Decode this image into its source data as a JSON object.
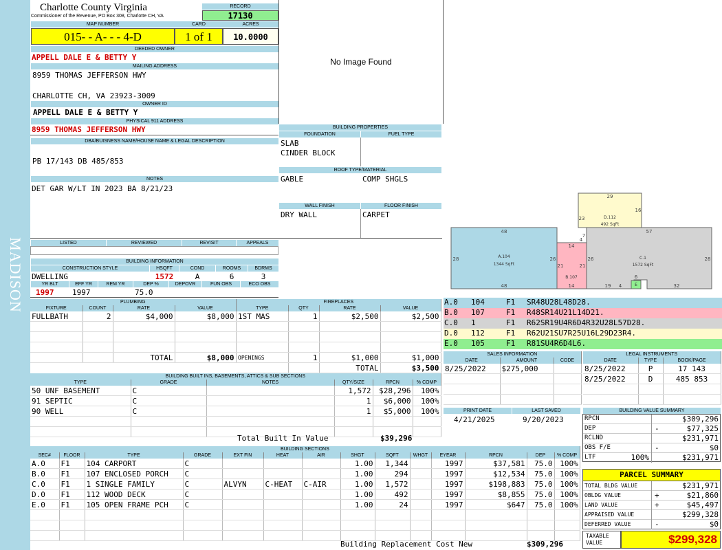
{
  "sidebar_label": "MADISON",
  "county": {
    "title": "Charlotte County Virginia",
    "subtitle": "Commissioner of the Revenue, PO Box 308, Charlotte CH, VA"
  },
  "record": {
    "label": "RECORD",
    "value": "17130"
  },
  "map": {
    "label": "MAP NUMBER",
    "value": "015- - A- - - 4-D"
  },
  "card": {
    "label": "CARD",
    "value": "1 of 1"
  },
  "acres": {
    "label": "ACRES",
    "value": "10.0000"
  },
  "deeded_owner": {
    "label": "DEEDED OWNER",
    "value": "APPELL DALE E & BETTY Y"
  },
  "mailing": {
    "label": "MAILING ADDRESS",
    "line1": "8959 THOMAS JEFFERSON HWY",
    "line2": "CHARLOTTE CH, VA 23923-3009"
  },
  "owner_id": {
    "label": "OWNER ID",
    "value": "APPELL DALE E & BETTY Y"
  },
  "physical": {
    "label": "PHYSICAL 911 ADDRESS",
    "value": "8959 THOMAS JEFFERSON HWY"
  },
  "legal_desc": {
    "label": "DBA/BUISNESS NAME/HOUSE NAME & LEGAL DESCRIPTION",
    "value": "PB 17/143 DB 485/853"
  },
  "notes": {
    "label": "NOTES",
    "value": "DET GAR W/LT IN 2023 BA 8/21/23"
  },
  "status_headers": [
    "LISTED",
    "REVIEWED",
    "REVISIT",
    "APPEALS"
  ],
  "image_placeholder": "No Image Found",
  "building_props": {
    "label": "BUILDING PROPERTIES",
    "foundation_label": "FOUNDATION",
    "fuel_label": "FUEL TYPE",
    "foundation": [
      "SLAB",
      "CINDER BLOCK"
    ],
    "roof_label": "ROOF TYPE/MATERIAL",
    "roof_type": "GABLE",
    "roof_material": "COMP SHGLS",
    "wall_label": "WALL FINISH",
    "floor_label": "FLOOR FINISH",
    "wall": "DRY WALL",
    "floor": "CARPET"
  },
  "building_info": {
    "label": "BUILDING INFORMATION",
    "h1": [
      "CONSTRUCTION STYLE",
      "HSQFT",
      "COND",
      "ROOMS",
      "BDRMS"
    ],
    "v1": [
      "DWELLING",
      "1572",
      "A",
      "6",
      "3"
    ],
    "h2": [
      "YR BLT",
      "EFF YR",
      "REM YR",
      "DEP %",
      "DEPOVR",
      "FUN OBS",
      "ECO OBS"
    ],
    "v2": [
      "1997",
      "1997",
      "",
      "75.0",
      "",
      "",
      ""
    ]
  },
  "plumbing": {
    "label": "PLUMBING",
    "headers": [
      "FIXTURE",
      "COUNT",
      "RATE",
      "VALUE"
    ],
    "rows": [
      [
        "FULLBATH",
        "2",
        "$4,000",
        "$8,000"
      ]
    ],
    "total_label": "TOTAL",
    "total": "$8,000"
  },
  "fireplaces": {
    "label": "FIREPLACES",
    "headers": [
      "TYPE",
      "QTY",
      "RATE",
      "VALUE"
    ],
    "rows": [
      [
        "1ST MAS",
        "1",
        "$2,500",
        "$2,500"
      ]
    ],
    "openings_label": "OPENINGS",
    "openings": [
      "1",
      "$1,000",
      "$1,000"
    ],
    "total_label": "TOTAL",
    "total": "$3,500"
  },
  "sketch": {
    "labels": [
      {
        "name": "A.104",
        "area": "1344 SqFt"
      },
      {
        "name": "B.107",
        "area": ""
      },
      {
        "name": "C.1",
        "area": "1572 SqFt"
      },
      {
        "name": "D.112",
        "area": "492 SqFt"
      },
      {
        "name": "E",
        "area": ""
      }
    ],
    "dims": [
      "48",
      "28",
      "26",
      "48",
      "14",
      "21",
      "21",
      "14",
      "7",
      "4",
      "23",
      "16",
      "29",
      "57",
      "26",
      "28",
      "19",
      "4",
      "6",
      "32"
    ]
  },
  "sketch_legend": [
    {
      "code": "A.0",
      "num": "104",
      "fl": "F1",
      "path": "SR48U28L48D28.",
      "color": "#add8e6"
    },
    {
      "code": "B.0",
      "num": "107",
      "fl": "F1",
      "path": "R48SR14U21L14D21.",
      "color": "#ffb6c1"
    },
    {
      "code": "C.0",
      "num": "1",
      "fl": "F1",
      "path": "R62SR19U4R6D4R32U28L57D28.",
      "color": "#d3d3d3"
    },
    {
      "code": "D.0",
      "num": "112",
      "fl": "F1",
      "path": "R62U21SU7R25U16L29D23R4.",
      "color": "#fffacd"
    },
    {
      "code": "E.0",
      "num": "105",
      "fl": "F1",
      "path": "R81SU4R6D4L6.",
      "color": "#90ee90"
    }
  ],
  "sales": {
    "label": "SALES INFORMATION",
    "headers": [
      "DATE",
      "AMOUNT",
      "CODE"
    ],
    "rows": [
      [
        "8/25/2022",
        "$275,000",
        ""
      ]
    ]
  },
  "legal": {
    "label": "LEGAL INSTRUMENTS",
    "headers": [
      "DATE",
      "TYPE",
      "BOOK/PAGE"
    ],
    "rows": [
      [
        "8/25/2022",
        "P",
        "17 143"
      ],
      [
        "8/25/2022",
        "D",
        "485 853"
      ]
    ]
  },
  "print": {
    "label": "PRINT DATE",
    "value": "4/21/2025"
  },
  "saved": {
    "label": "LAST SAVED",
    "value": "9/20/2023"
  },
  "builtins": {
    "label": "BUILDING BUILT INS, BASEMENTS, ATTICS & SUB SECTIONS",
    "headers": [
      "TYPE",
      "GRADE",
      "NOTES",
      "QTY/SIZE",
      "RPCN",
      "% COMP"
    ],
    "rows": [
      [
        "50 UNF BASEMENT",
        "C",
        "",
        "1,572",
        "$28,296",
        "100%"
      ],
      [
        "91 SEPTIC",
        "C",
        "",
        "1",
        "$6,000",
        "100%"
      ],
      [
        "90 WELL",
        "C",
        "",
        "1",
        "$5,000",
        "100%"
      ]
    ],
    "total_label": "Total Built In Value",
    "total": "$39,296"
  },
  "sections": {
    "label": "BUILDING SECTIONS",
    "headers": [
      "SEC#",
      "FLOOR",
      "TYPE",
      "GRADE",
      "EXT FIN",
      "HEAT",
      "AIR",
      "SHGT",
      "SQFT",
      "WHGT",
      "EYEAR",
      "RPCN",
      "DEP",
      "% COMP"
    ],
    "rows": [
      [
        "A.0",
        "F1",
        "104 CARPORT",
        "C",
        "",
        "",
        "",
        "1.00",
        "1,344",
        "",
        "1997",
        "$37,581",
        "75.0",
        "100%"
      ],
      [
        "B.0",
        "F1",
        "107 ENCLOSED PORCH",
        "C",
        "",
        "",
        "",
        "1.00",
        "294",
        "",
        "1997",
        "$12,534",
        "75.0",
        "100%"
      ],
      [
        "C.0",
        "F1",
        "1 SINGLE FAMILY",
        "C",
        "ALVYN",
        "C-HEAT",
        "C-AIR",
        "1.00",
        "1,572",
        "",
        "1997",
        "$198,883",
        "75.0",
        "100%"
      ],
      [
        "D.0",
        "F1",
        "112 WOOD DECK",
        "C",
        "",
        "",
        "",
        "1.00",
        "492",
        "",
        "1997",
        "$8,855",
        "75.0",
        "100%"
      ],
      [
        "E.0",
        "F1",
        "105 OPEN FRAME PCH",
        "C",
        "",
        "",
        "",
        "1.00",
        "24",
        "",
        "1997",
        "$647",
        "75.0",
        "100%"
      ]
    ],
    "total_label": "Building Replacement Cost New",
    "total": "$309,296"
  },
  "value_summary": {
    "label": "BUILDING VALUE SUMMARY",
    "rows": [
      {
        "label": "RPCN",
        "pct": "",
        "sign": "",
        "value": "$309,296"
      },
      {
        "label": "DEP",
        "pct": "",
        "sign": "-",
        "value": "$77,325"
      },
      {
        "label": "RCLND",
        "pct": "",
        "sign": "",
        "value": "$231,971"
      },
      {
        "label": "OBS F/E",
        "pct": "",
        "sign": "-",
        "value": "$0"
      },
      {
        "label": "LTF",
        "pct": "100%",
        "sign": "",
        "value": "$231,971"
      }
    ]
  },
  "parcel_summary": {
    "label": "PARCEL SUMMARY",
    "rows": [
      {
        "label": "TOTAL BLDG VALUE",
        "sign": "",
        "value": "$231,971"
      },
      {
        "label": "OBLDG VALUE",
        "sign": "+",
        "value": "$21,860"
      },
      {
        "label": "LAND VALUE",
        "sign": "+",
        "value": "$45,497"
      },
      {
        "label": "APPRAISED VALUE",
        "sign": "",
        "value": "$299,328"
      },
      {
        "label": "DEFERRED VALUE",
        "sign": "-",
        "value": "$0"
      }
    ],
    "taxable_label_1": "TAXABLE",
    "taxable_label_2": "VALUE",
    "taxable": "$299,328"
  }
}
